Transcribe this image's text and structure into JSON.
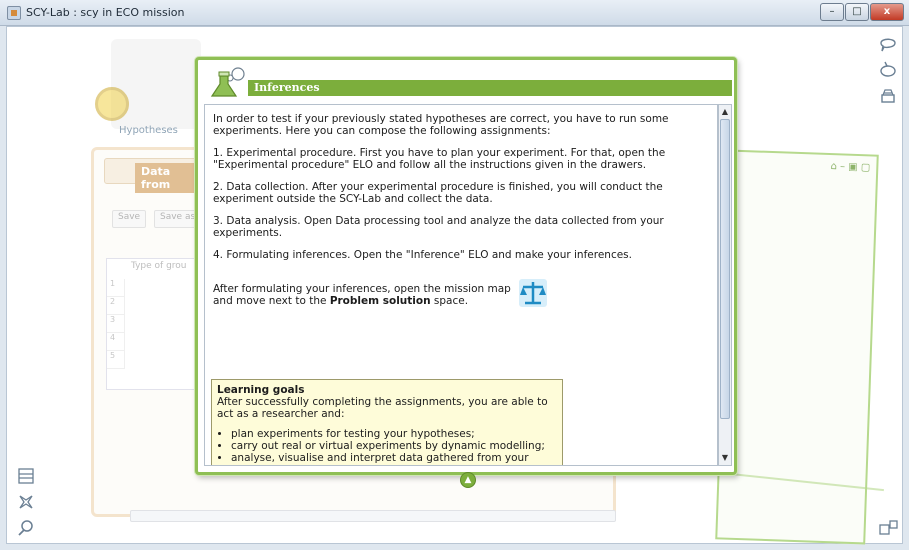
{
  "window": {
    "title": "SCY-Lab : scy in ECO mission",
    "min_glyph": "–",
    "max_glyph": "□",
    "close_glyph": "x"
  },
  "background": {
    "hypotheses_label": "Hypotheses",
    "data_frame_title": "Data from",
    "buttons": [
      "Save",
      "Save as"
    ],
    "table_column": "Type of grou",
    "row_numbers": [
      "1",
      "2",
      "3",
      "4",
      "5"
    ]
  },
  "dialog": {
    "title": "Inferences",
    "intro": "In order to test if your previously stated hypotheses are correct, you have to run some experiments. Here you can compose the following assignments:",
    "steps": [
      "1. Experimental procedure. First you have to plan your experiment. For that, open the \"Experimental procedure\" ELO and follow all the instructions given in the drawers.",
      "2. Data collection. After your experimental procedure is finished, you will conduct the experiment outside the SCY-Lab and collect the data.",
      "3. Data analysis. Open Data processing tool and analyze the data collected from your experiments.",
      "4. Formulating inferences. Open the \"Inference\" ELO and make your inferences."
    ],
    "after_prefix": "After formulating your inferences, open the mission map and move next to the ",
    "after_bold": "Problem solution",
    "after_suffix": " space.",
    "goals": {
      "title": "Learning goals",
      "intro": "After successfully completing the assignments, you are able to act as a researcher and:",
      "items": [
        "plan experiments for testing your hypotheses;",
        "carry out real or virtual experiments by dynamic modelling;",
        "analyse, visualise and interpret data gathered from your"
      ]
    }
  },
  "icons": {
    "right": [
      "speech-bubble-icon",
      "lasso-icon",
      "stack-icon"
    ],
    "left": [
      "list-icon",
      "star-tool-icon",
      "search-icon"
    ],
    "bottom_right": "windows-icon"
  },
  "colors": {
    "accent_green": "#7cae3c",
    "goals_bg": "#fefcd9",
    "frame_orange": "#eccfa6"
  }
}
